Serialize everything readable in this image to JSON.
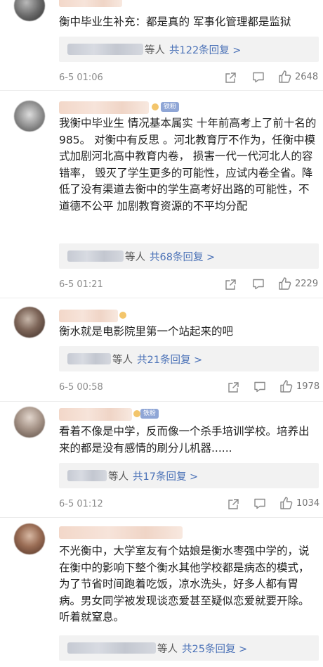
{
  "comments": [
    {
      "text": "衡中毕业生补充：都是真的 军事化管理都是监狱",
      "reply_etc": "等人",
      "reply_link": "共122条回复 >",
      "time": "6-5 01:06",
      "likes": "2648"
    },
    {
      "badge": "铁粉",
      "text": "我衡中毕业生 情况基本属实 十年前高考上了前十名的985。 对衡中有反思 。河北教育厅不作为，任衡中模式加剧河北高中教育内卷， 损害一代一代河北人的容错率， 毁灭了学生更多的可能性，应试内卷全省。降低了没有渠道去衡中的学生高考好出路的可能性，不道德不公平 加剧教育资源的不平均分配",
      "reply_etc": "等人",
      "reply_link": "共68条回复 >",
      "time": "6-5 01:21",
      "likes": "2229"
    },
    {
      "text": "衡水就是电影院里第一个站起来的吧",
      "reply_etc": "等人",
      "reply_link": "共21条回复 >",
      "time": "6-5 00:58",
      "likes": "1978"
    },
    {
      "badge": "铁粉",
      "text": "看着不像是中学，反而像一个杀手培训学校。培养出来的都是没有感情的刷分儿机器......",
      "reply_etc": "等人",
      "reply_link": "共17条回复 >",
      "time": "6-5 01:12",
      "likes": "1034"
    },
    {
      "text": "不光衡中，大学室友有个姑娘是衡水枣强中学的，说在衡中的影响下整个衡水其他学校都是病态的模式，为了节省时间跑着吃饭，凉水洗头，好多人都有胃病。男女同学被发现谈恋爱甚至疑似恋爱就要开除。听着就窒息。",
      "reply_etc": "等人",
      "reply_link": "共25条回复 >",
      "time": "",
      "likes": ""
    }
  ],
  "colors": {
    "link": "#4a71b7",
    "meta": "#8c8c8c",
    "reply_bg": "#f2f2f2"
  },
  "icons": [
    "share-icon",
    "comment-icon",
    "like-icon"
  ]
}
